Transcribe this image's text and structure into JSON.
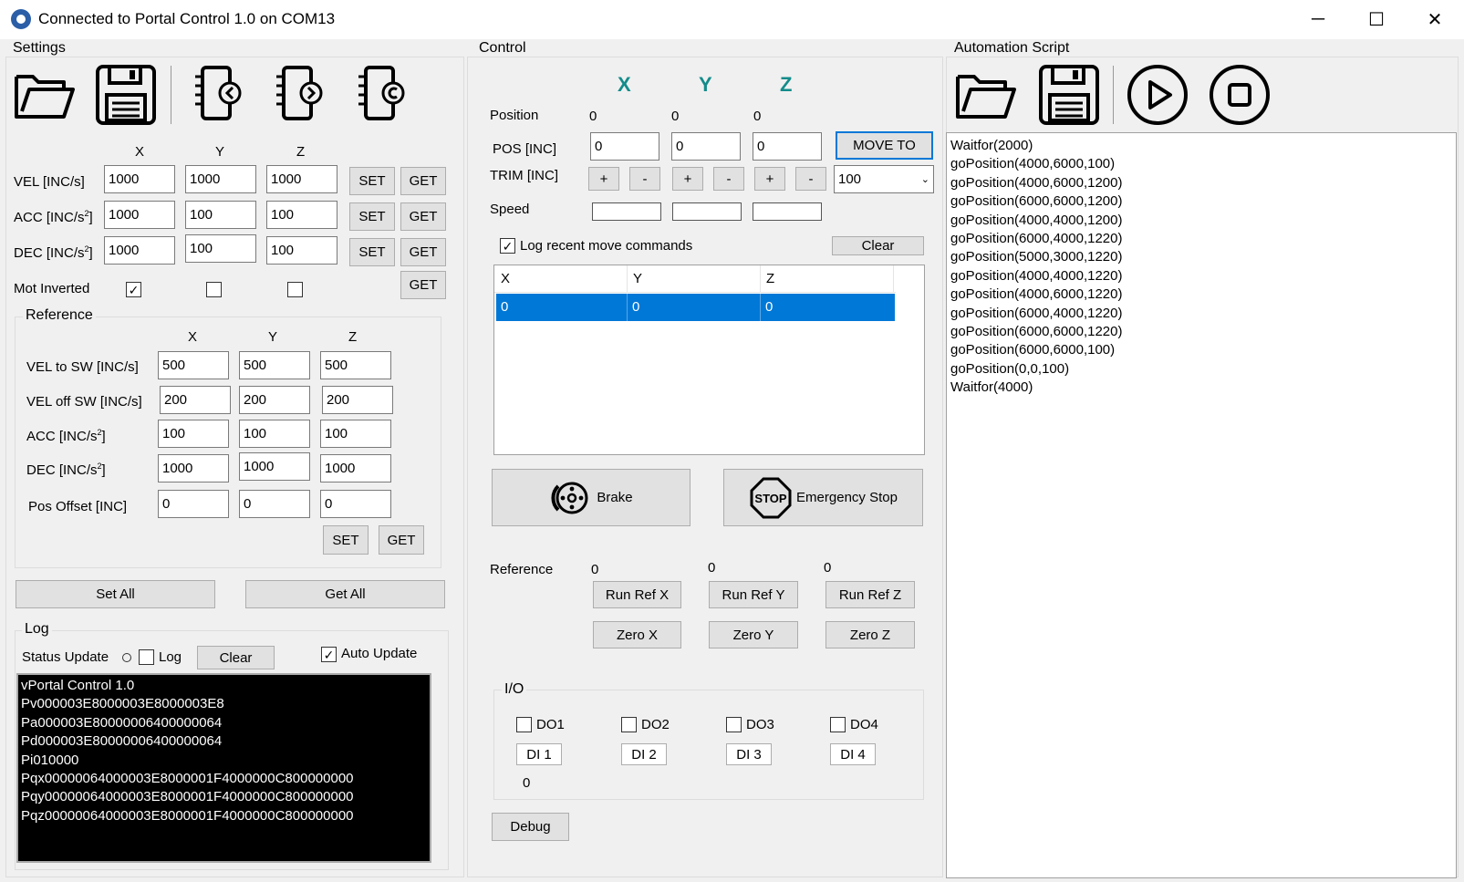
{
  "window": {
    "title": "Connected to Portal Control 1.0 on COM13",
    "minimize_glyph": "─",
    "maximize_glyph": "☐",
    "close_glyph": "✕"
  },
  "settings": {
    "title": "Settings",
    "toolbar_icons": [
      "open-folder-icon",
      "save-disk-icon",
      "device-upload-icon",
      "device-download-icon",
      "device-reset-icon"
    ],
    "axes": [
      "X",
      "Y",
      "Z"
    ],
    "rows": [
      {
        "label_main": "VEL [INC/s]",
        "label_sup": "",
        "label_tail": "",
        "x": "1000",
        "y": "1000",
        "z": "1000"
      },
      {
        "label_main": "ACC [INC/s",
        "label_sup": "2",
        "label_tail": "]",
        "x": "1000",
        "y": "100",
        "z": "100"
      },
      {
        "label_main": "DEC [INC/s",
        "label_sup": "2",
        "label_tail": "]",
        "x": "1000",
        "y": "100",
        "z": "100"
      }
    ],
    "set_label": "SET",
    "get_label": "GET",
    "mot_inverted_label": "Mot Inverted",
    "mot_inverted": {
      "x": true,
      "y": false,
      "z": false
    },
    "check_glyph": "✓",
    "reference": {
      "title": "Reference",
      "axes": [
        "X",
        "Y",
        "Z"
      ],
      "rows": [
        {
          "label_main": "VEL to SW [INC/s]",
          "label_sup": "",
          "label_tail": "",
          "x": "500",
          "y": "500",
          "z": "500"
        },
        {
          "label_main": "VEL off SW [INC/s]",
          "label_sup": "",
          "label_tail": "",
          "x": "200",
          "y": "200",
          "z": "200"
        },
        {
          "label_main": "ACC [INC/s",
          "label_sup": "2",
          "label_tail": "]",
          "x": "100",
          "y": "100",
          "z": "100"
        },
        {
          "label_main": "DEC [INC/s",
          "label_sup": "2",
          "label_tail": "]",
          "x": "1000",
          "y": "1000",
          "z": "1000"
        },
        {
          "label_main": "Pos Offset [INC]",
          "label_sup": "",
          "label_tail": "",
          "x": "0",
          "y": "0",
          "z": "0"
        }
      ],
      "set_label": "SET",
      "get_label": "GET"
    },
    "set_all_label": "Set All",
    "get_all_label": "Get All"
  },
  "log": {
    "title": "Log",
    "status_update_label": "Status Update",
    "log_label": "Log",
    "clear_label": "Clear",
    "auto_update_label": "Auto Update",
    "lines": [
      "vPortal Control 1.0",
      "Pv000003E8000003E8000003E8",
      "Pa000003E80000006400000064",
      "Pd000003E80000006400000064",
      "Pi010000",
      "Pqx00000064000003E8000001F4000000C800000000",
      "Pqy00000064000003E8000001F4000000C800000000",
      "Pqz00000064000003E8000001F4000000C800000000"
    ]
  },
  "control": {
    "title": "Control",
    "axes": [
      "X",
      "Y",
      "Z"
    ],
    "position_label": "Position",
    "position": {
      "x": "0",
      "y": "0",
      "z": "0"
    },
    "pos_label": "POS [INC]",
    "pos_inputs": {
      "x": "0",
      "y": "0",
      "z": "0"
    },
    "move_to_label": "MOVE TO",
    "trim_label": "TRIM [INC]",
    "plus": "+",
    "minus": "-",
    "trim_step": "100",
    "speed_label": "Speed",
    "log_recent_label": "Log recent move commands",
    "clear_label": "Clear",
    "list_headers": [
      "X",
      "Y",
      "Z"
    ],
    "list_rows": [
      [
        "0",
        "0",
        "0"
      ]
    ],
    "brake_label": "Brake",
    "estop_label": "Emergency Stop",
    "stop_sign_text": "STOP",
    "reference_label": "Reference",
    "reference_values": {
      "x": "0",
      "y": "0",
      "z": "0"
    },
    "run_ref": [
      "Run Ref X",
      "Run Ref Y",
      "Run Ref Z"
    ],
    "zero": [
      "Zero X",
      "Zero Y",
      "Zero Z"
    ],
    "io": {
      "title": "I/O",
      "do": [
        "DO1",
        "DO2",
        "DO3",
        "DO4"
      ],
      "di": [
        "DI 1",
        "DI 2",
        "DI 3",
        "DI 4"
      ],
      "value": "0"
    },
    "debug_label": "Debug"
  },
  "automation": {
    "title": "Automation Script",
    "toolbar_icons": [
      "open-folder-icon",
      "save-disk-icon",
      "play-icon",
      "stop-icon"
    ],
    "script_lines": [
      "Waitfor(2000)",
      "goPosition(4000,6000,100)",
      "goPosition(4000,6000,1200)",
      "goPosition(6000,6000,1200)",
      "goPosition(4000,4000,1200)",
      "goPosition(6000,4000,1220)",
      "goPosition(5000,3000,1220)",
      "goPosition(4000,4000,1220)",
      "goPosition(4000,6000,1220)",
      "goPosition(6000,4000,1220)",
      "goPosition(6000,6000,1220)",
      "goPosition(6000,6000,100)",
      "goPosition(0,0,100)",
      "Waitfor(4000)"
    ]
  },
  "colors": {
    "selection": "#0078d7",
    "teal_axis": "#138c8a",
    "log_bg": "#000000"
  }
}
